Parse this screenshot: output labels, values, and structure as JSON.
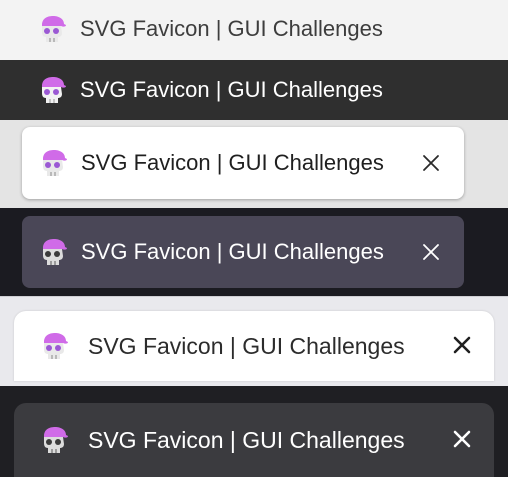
{
  "tab_title": "SVG Favicon | GUI Challenges",
  "icons": {
    "favicon": "skull-with-cap-icon",
    "close": "close-x-icon"
  },
  "colors": {
    "cap_purple": "#d06be8",
    "skull_light": "#e9e9e9",
    "skull_eyes": "#9b59d4"
  },
  "rows": [
    {
      "theme": "light",
      "style": "flat",
      "title": "SVG Favicon | GUI Challenges",
      "has_close": false
    },
    {
      "theme": "dark",
      "style": "flat",
      "title": "SVG Favicon | GUI Challenges",
      "has_close": false
    },
    {
      "theme": "light",
      "style": "card",
      "title": "SVG Favicon | GUI Challenges",
      "has_close": true
    },
    {
      "theme": "dark",
      "style": "card",
      "title": "SVG Favicon | GUI Challenges",
      "has_close": true
    },
    {
      "theme": "light",
      "style": "rounded-tab",
      "title": "SVG Favicon | GUI Challenges",
      "has_close": true
    },
    {
      "theme": "dark",
      "style": "rounded-tab",
      "title": "SVG Favicon | GUI Challenges",
      "has_close": true
    }
  ]
}
